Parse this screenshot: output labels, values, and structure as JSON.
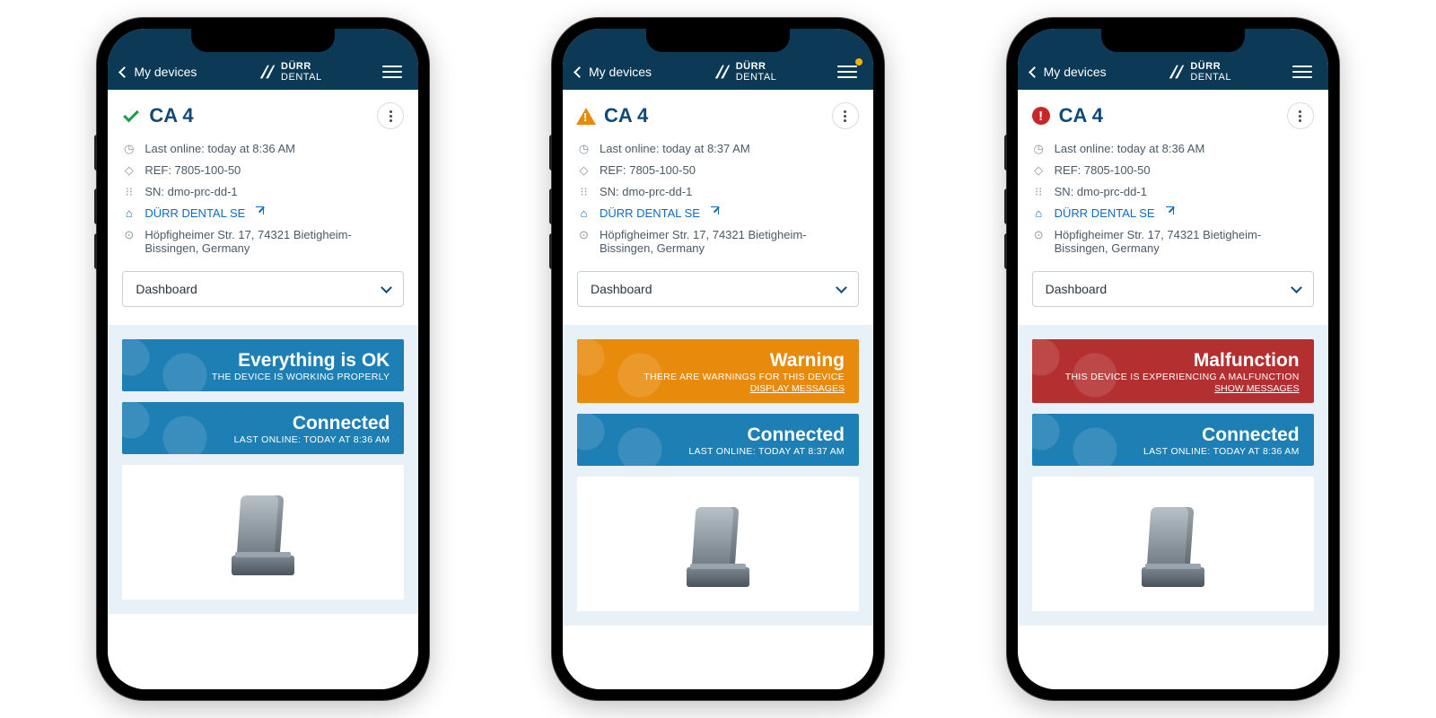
{
  "brand": {
    "top": "DÜRR",
    "bottom": "DENTAL"
  },
  "header": {
    "back_label": "My devices"
  },
  "common": {
    "title": "CA 4",
    "ref_label": "REF: 7805-100-50",
    "sn_label": "SN: dmo-prc-dd-1",
    "org_link": "DÜRR DENTAL SE",
    "address": "Höpfigheimer Str. 17, 74321 Bietigheim-Bissingen, Germany",
    "select_value": "Dashboard"
  },
  "phones": [
    {
      "status": "ok",
      "menu_dot": false,
      "last_online": "Last online: today at 8:36 AM",
      "card1": {
        "title": "Everything is OK",
        "sub": "THE DEVICE IS WORKING PROPERLY",
        "link": ""
      },
      "conn": {
        "title": "Connected",
        "sub": "LAST ONLINE: TODAY AT 8:36 AM"
      }
    },
    {
      "status": "warn",
      "menu_dot": true,
      "last_online": "Last online: today at 8:37 AM",
      "card1": {
        "title": "Warning",
        "sub": "THERE ARE WARNINGS FOR THIS DEVICE",
        "link": "DISPLAY MESSAGES"
      },
      "conn": {
        "title": "Connected",
        "sub": "LAST ONLINE: TODAY AT 8:37 AM"
      }
    },
    {
      "status": "mal",
      "menu_dot": false,
      "last_online": "Last online: today at 8:36 AM",
      "card1": {
        "title": "Malfunction",
        "sub": "THIS DEVICE IS EXPERIENCING A MALFUNCTION",
        "link": "SHOW MESSAGES"
      },
      "conn": {
        "title": "Connected",
        "sub": "LAST ONLINE: TODAY AT 8:36 AM"
      }
    }
  ]
}
